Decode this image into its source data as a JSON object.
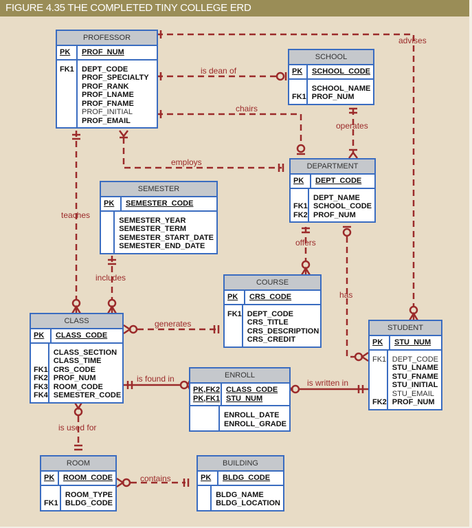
{
  "figure_title": "FIGURE 4.35  THE COMPLETED TINY COLLEGE ERD",
  "colors": {
    "title_bar": "#9a8d57",
    "background": "#e8dcc6",
    "entity_border": "#3a6cc0",
    "entity_header": "#c5c8cc",
    "relationship_line": "#9b2a2a"
  },
  "entities": {
    "professor": {
      "name": "PROFESSOR",
      "pk_keys": [
        "PK"
      ],
      "pk_attrs": [
        "PROF_NUM"
      ],
      "keys": [
        "FK1",
        "",
        "",
        "",
        "",
        "",
        ""
      ],
      "attrs": [
        "DEPT_CODE",
        "PROF_SPECIALTY",
        "PROF_RANK",
        "PROF_LNAME",
        "PROF_FNAME",
        "PROF_INITIAL",
        "PROF_EMAIL"
      ]
    },
    "school": {
      "name": "SCHOOL",
      "pk_keys": [
        "PK"
      ],
      "pk_attrs": [
        "SCHOOL_CODE"
      ],
      "keys": [
        "",
        "FK1"
      ],
      "attrs": [
        "SCHOOL_NAME",
        "PROF_NUM"
      ]
    },
    "department": {
      "name": "DEPARTMENT",
      "pk_keys": [
        "PK"
      ],
      "pk_attrs": [
        "DEPT_CODE"
      ],
      "keys": [
        "",
        "FK1",
        "FK2"
      ],
      "attrs": [
        "DEPT_NAME",
        "SCHOOL_CODE",
        "PROF_NUM"
      ]
    },
    "semester": {
      "name": "SEMESTER",
      "pk_keys": [
        "PK"
      ],
      "pk_attrs": [
        "SEMESTER_CODE"
      ],
      "keys": [
        "",
        "",
        "",
        ""
      ],
      "attrs": [
        "SEMESTER_YEAR",
        "SEMESTER_TERM",
        "SEMESTER_START_DATE",
        "SEMESTER_END_DATE"
      ]
    },
    "course": {
      "name": "COURSE",
      "pk_keys": [
        "PK"
      ],
      "pk_attrs": [
        "CRS_CODE"
      ],
      "keys": [
        "FK1",
        "",
        "",
        ""
      ],
      "attrs": [
        "DEPT_CODE",
        "CRS_TITLE",
        "CRS_DESCRIPTION",
        "CRS_CREDIT"
      ]
    },
    "class": {
      "name": "CLASS",
      "pk_keys": [
        "PK"
      ],
      "pk_attrs": [
        "CLASS_CODE"
      ],
      "keys": [
        "",
        "",
        "FK1",
        "FK2",
        "FK3",
        "FK4"
      ],
      "attrs": [
        "CLASS_SECTION",
        "CLASS_TIME",
        "CRS_CODE",
        "PROF_NUM",
        "ROOM_CODE",
        "SEMESTER_CODE"
      ]
    },
    "student": {
      "name": "STUDENT",
      "pk_keys": [
        "PK"
      ],
      "pk_attrs": [
        "STU_NUM"
      ],
      "keys": [
        "FK1",
        "",
        "",
        "",
        "",
        "FK2"
      ],
      "attrs": [
        "DEPT_CODE",
        "STU_LNAME",
        "STU_FNAME",
        "STU_INITIAL",
        "STU_EMAIL",
        "PROF_NUM"
      ]
    },
    "enroll": {
      "name": "ENROLL",
      "pk_keys": [
        "PK,FK2",
        "PK,FK1"
      ],
      "pk_attrs": [
        "CLASS_CODE",
        "STU_NUM"
      ],
      "keys": [
        "",
        ""
      ],
      "attrs": [
        "ENROLL_DATE",
        "ENROLL_GRADE"
      ]
    },
    "room": {
      "name": "ROOM",
      "pk_keys": [
        "PK"
      ],
      "pk_attrs": [
        "ROOM_CODE"
      ],
      "keys": [
        "",
        "FK1"
      ],
      "attrs": [
        "ROOM_TYPE",
        "BLDG_CODE"
      ]
    },
    "building": {
      "name": "BUILDING",
      "pk_keys": [
        "PK"
      ],
      "pk_attrs": [
        "BLDG_CODE"
      ],
      "keys": [
        "",
        ""
      ],
      "attrs": [
        "BLDG_NAME",
        "BLDG_LOCATION"
      ]
    }
  },
  "relationships": {
    "advises": "advises",
    "is_dean_of": "is dean of",
    "chairs": "chairs",
    "operates": "operates",
    "employs": "employs",
    "teaches": "teaches",
    "offers": "offers",
    "includes": "includes",
    "has": "has",
    "generates": "generates",
    "is_found_in": "is found in",
    "is_written_in": "is written in",
    "is_used_for": "is used for",
    "contains": "contains"
  }
}
